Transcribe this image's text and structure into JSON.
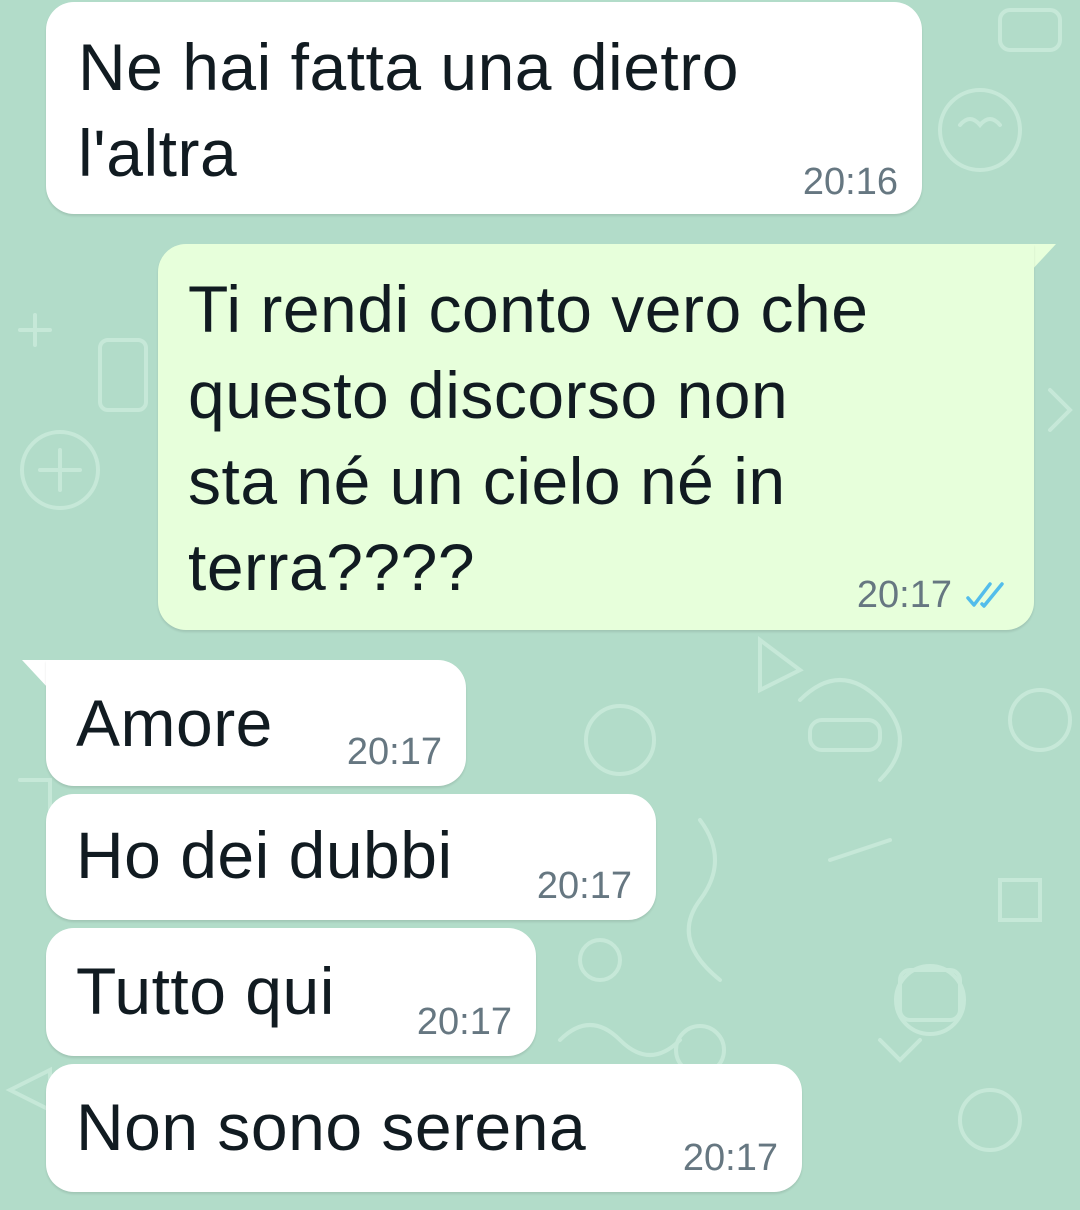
{
  "colors": {
    "background": "#b2dcc9",
    "incoming_bubble": "#ffffff",
    "outgoing_bubble": "#e7ffdb",
    "timestamp": "#667781",
    "read_ticks": "#53bdeb"
  },
  "messages": [
    {
      "direction": "incoming",
      "text": "Ne hai fatta una dietro\nl'altra",
      "time": "20:16"
    },
    {
      "direction": "outgoing",
      "text": "Ti rendi conto vero che\nquesto discorso non\nsta né un cielo né in\nterra????",
      "time": "20:17",
      "status_icon": "double-check-read-icon"
    },
    {
      "direction": "incoming",
      "text": "Amore",
      "time": "20:17"
    },
    {
      "direction": "incoming",
      "text": "Ho dei dubbi",
      "time": "20:17"
    },
    {
      "direction": "incoming",
      "text": "Tutto qui",
      "time": "20:17"
    },
    {
      "direction": "incoming",
      "text": "Non sono serena",
      "time": "20:17"
    }
  ]
}
